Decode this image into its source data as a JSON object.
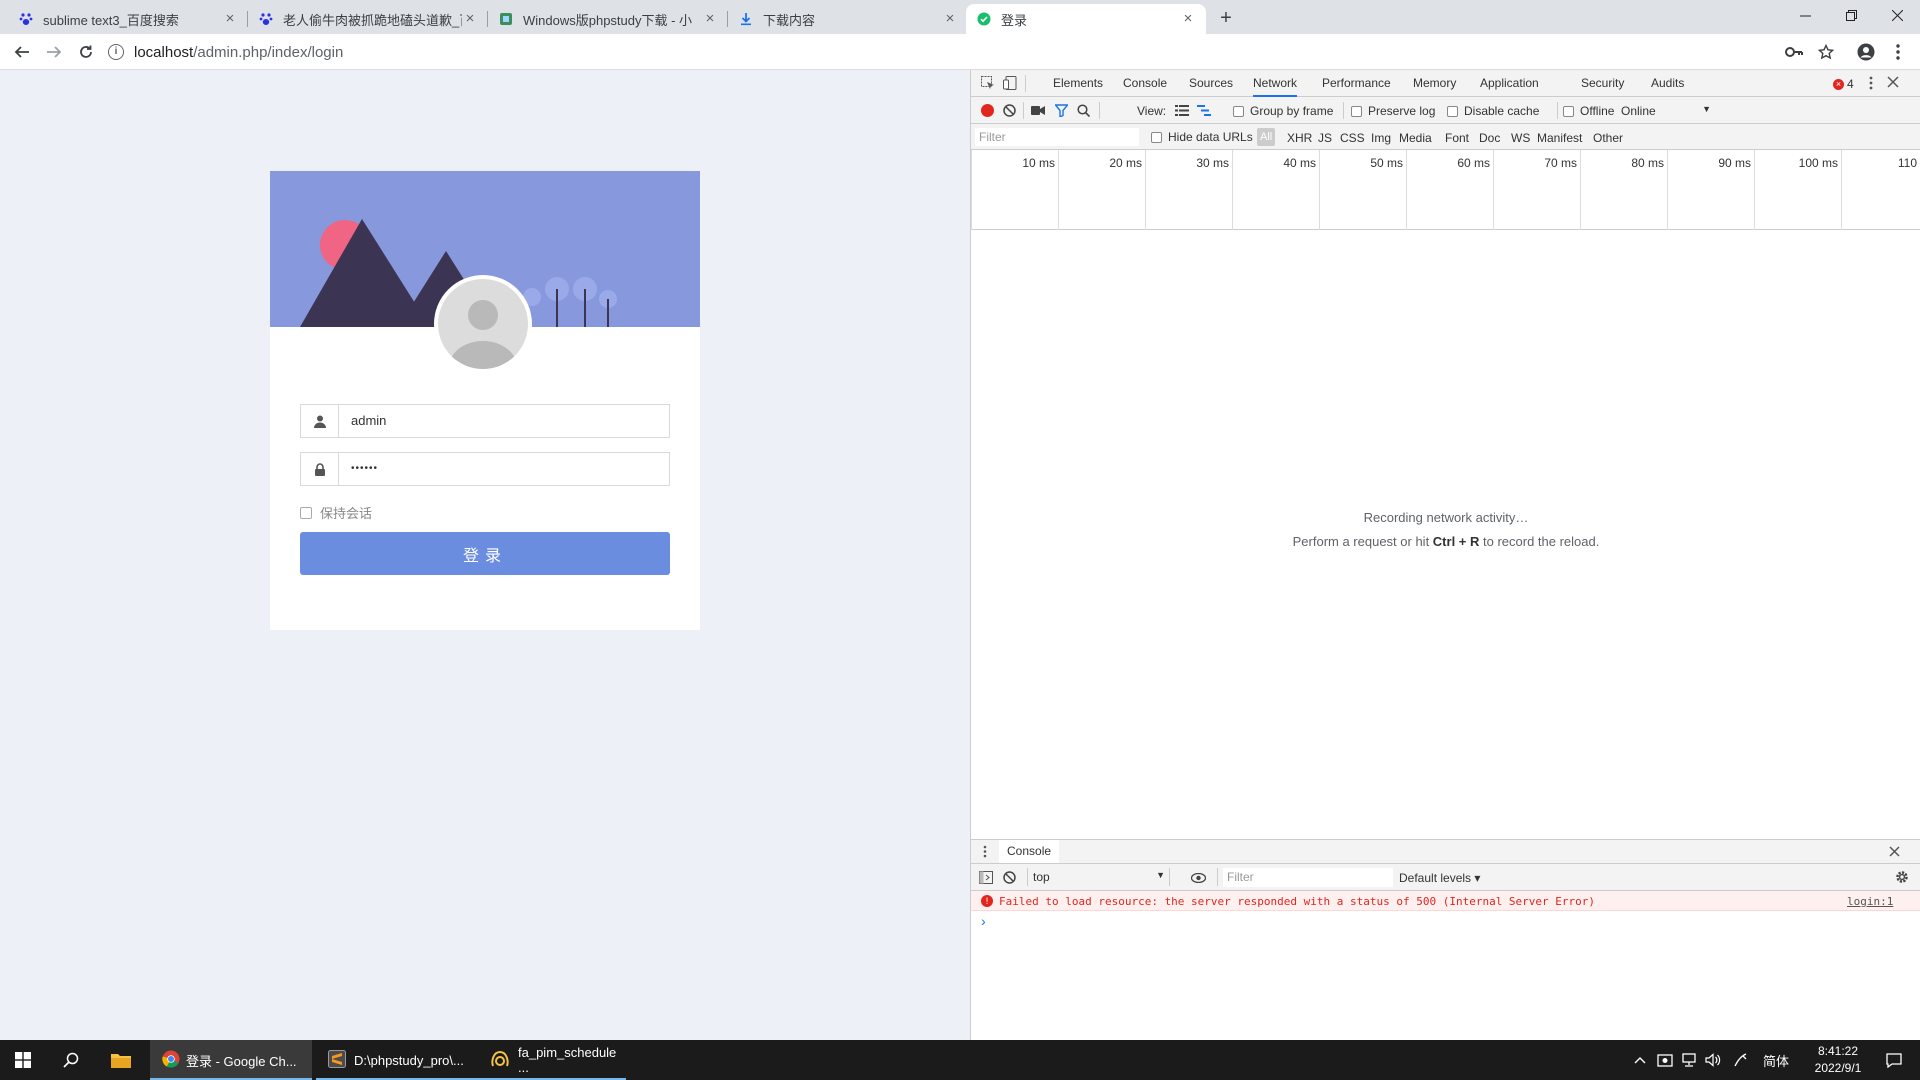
{
  "browser": {
    "tabs": [
      {
        "label": "sublime text3_百度搜索",
        "icon": "baidu-paw-icon",
        "active": false
      },
      {
        "label": "老人偷牛肉被抓跪地磕头道歉_百",
        "icon": "baidu-paw-icon",
        "active": false
      },
      {
        "label": "Windows版phpstudy下载 - 小",
        "icon": "phpstudy-icon",
        "active": false
      },
      {
        "label": "下载内容",
        "icon": "download-icon",
        "active": false
      },
      {
        "label": "登录",
        "icon": "page-icon",
        "active": true
      }
    ],
    "new_tab": "+",
    "url_host": "localhost",
    "url_path": "/admin.php/index/login"
  },
  "login": {
    "username": "admin",
    "password_mask": "••••••",
    "remember_label": "保持会话",
    "submit_label": "登录"
  },
  "devtools": {
    "tabs": [
      "Elements",
      "Console",
      "Sources",
      "Network",
      "Performance",
      "Memory",
      "Application",
      "Security",
      "Audits"
    ],
    "active_tab": "Network",
    "error_count": "4",
    "view_label": "View:",
    "group_by_frame": "Group by frame",
    "preserve_log": "Preserve log",
    "disable_cache": "Disable cache",
    "offline": "Offline",
    "throttle": "Online",
    "filter_placeholder": "Filter",
    "hide_data_urls": "Hide data URLs",
    "type_filters": [
      "All",
      "XHR",
      "JS",
      "CSS",
      "Img",
      "Media",
      "Font",
      "Doc",
      "WS",
      "Manifest",
      "Other"
    ],
    "timeline_ticks": [
      "10 ms",
      "20 ms",
      "30 ms",
      "40 ms",
      "50 ms",
      "60 ms",
      "70 ms",
      "80 ms",
      "90 ms",
      "100 ms",
      "110"
    ],
    "recording_text": "Recording network activity…",
    "hint_prefix": "Perform a request or hit ",
    "hint_shortcut": "Ctrl + R",
    "hint_suffix": " to record the reload.",
    "drawer": {
      "title": "Console",
      "context": "top",
      "filter_placeholder": "Filter",
      "levels": "Default levels ▾",
      "error_message": "Failed to load resource: the server responded with a status of 500 (Internal Server Error)",
      "error_source": "login:1",
      "prompt": "›"
    }
  },
  "taskbar": {
    "items": [
      {
        "label": "登录 - Google Ch...",
        "icon": "chrome-icon"
      },
      {
        "label": "D:\\phpstudy_pro\\...",
        "icon": "sublime-icon"
      },
      {
        "label": "fa_pim_schedule ...",
        "icon": "navicat-icon"
      }
    ],
    "ime": "简体",
    "time": "8:41:22",
    "date": "2022/9/1"
  },
  "colors": {
    "accent": "#1a73e8",
    "login_button": "#6b8de0",
    "banner": "#8799dc",
    "error": "#e0261f"
  }
}
